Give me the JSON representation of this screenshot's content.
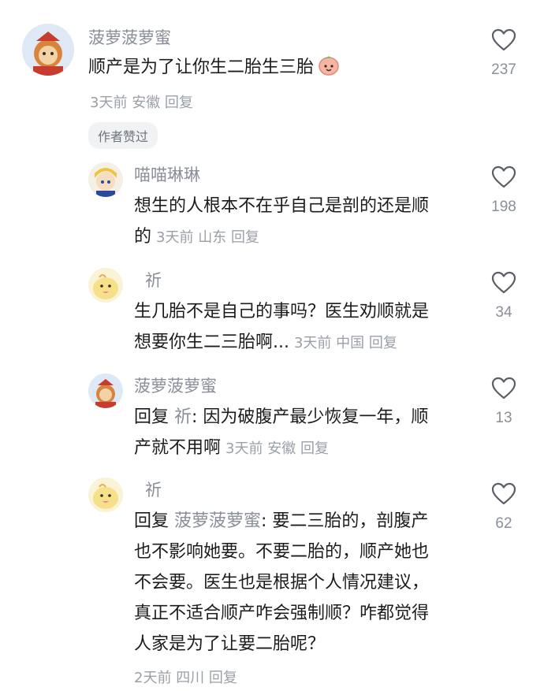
{
  "comments": [
    {
      "username": "菠萝菠萝蜜",
      "lines": [
        "顺产是为了让你生二胎生三胎"
      ],
      "emoji": "peach-face-emoji",
      "time": "3天前",
      "location": "安徽",
      "reply": "回复",
      "likes": "237",
      "badge": "作者赞过"
    },
    {
      "username": "喵喵琳琳",
      "lines": [
        "想生的人根本不在乎自己是剖的还是顺",
        "的"
      ],
      "time": "3天前",
      "location": "山东",
      "reply": "回复",
      "likes": "198"
    },
    {
      "username": "祈",
      "lines": [
        "生几胎不是自己的事吗？医生劝顺就是",
        "想要你生二三胎啊..."
      ],
      "time": "3天前",
      "location": "中国",
      "reply": "回复",
      "likes": "34"
    },
    {
      "username": "菠萝菠萝蜜",
      "reply_prefix": "回复",
      "reply_to": "祈",
      "lines": [
        ": 因为破腹产最少恢复一年，顺",
        "产就不用啊"
      ],
      "time": "3天前",
      "location": "安徽",
      "reply": "回复",
      "likes": "13"
    },
    {
      "username": "祈",
      "reply_prefix": "回复",
      "reply_to": "菠萝菠萝蜜",
      "lines": [
        ": 要二三胎的，剖腹产",
        "也不影响她要。不要二胎的，顺产她也",
        "不会要。医生也是根据个人情况建议，",
        "真正不适合顺产咋会强制顺？咋都觉得",
        "人家是为了让要二胎呢？"
      ],
      "time": "2天前",
      "location": "四川",
      "reply": "回复",
      "likes": "62"
    }
  ],
  "colors": {
    "meta": "#9aa0a8",
    "username": "#8a8f99",
    "text": "#1c1c1c",
    "badge_bg": "#f1f2f4"
  }
}
